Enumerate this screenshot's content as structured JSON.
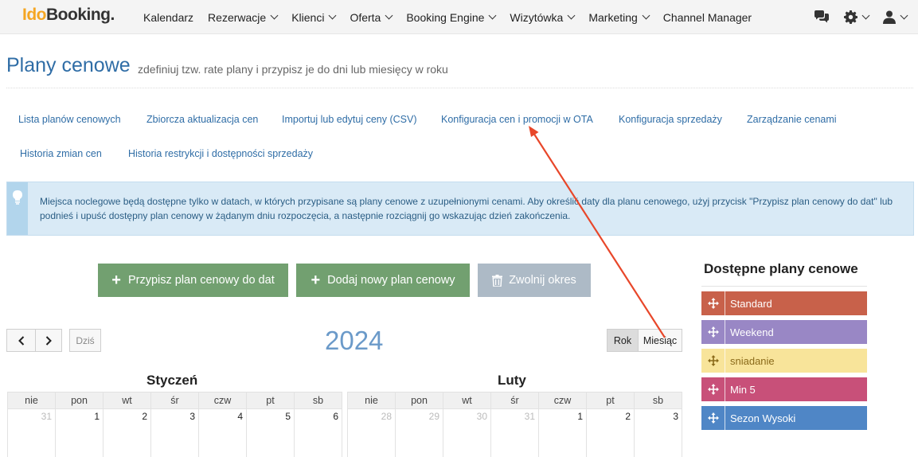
{
  "brand": {
    "ido": "Ido",
    "booking": "Booking",
    "dot": "."
  },
  "nav": [
    {
      "label": "Kalendarz",
      "dropdown": false
    },
    {
      "label": "Rezerwacje",
      "dropdown": true
    },
    {
      "label": "Klienci",
      "dropdown": true
    },
    {
      "label": "Oferta",
      "dropdown": true
    },
    {
      "label": "Booking Engine",
      "dropdown": true
    },
    {
      "label": "Wizytówka",
      "dropdown": true
    },
    {
      "label": "Marketing",
      "dropdown": true
    },
    {
      "label": "Channel Manager",
      "dropdown": false
    }
  ],
  "top_icons": [
    "chat-icon",
    "gear-icon",
    "user-icon"
  ],
  "page": {
    "title": "Plany cenowe",
    "subtitle": "zdefiniuj tzw. rate plany i przypisz je do dni lub miesięcy w roku"
  },
  "sublinks": [
    "Lista planów cenowych",
    "Zbiorcza aktualizacja cen",
    "Importuj lub edytuj ceny (CSV)",
    "Konfiguracja cen i promocji w OTA",
    "Konfiguracja sprzedaży",
    "Zarządzanie cenami",
    "Historia zmian cen",
    "Historia restrykcji i dostępności sprzedaży"
  ],
  "alert": {
    "icon": "lightbulb-icon",
    "text": "Miejsca noclegowe będą dostępne tylko w datach, w których przypisane są plany cenowe z uzupełnionymi cenami. Aby określić daty dla planu cenowego, użyj przycisk \"Przypisz plan cenowy do dat\" lub podnieś i upuść dostępny plan cenowy w żądanym dniu rozpoczęcia, a następnie rozciągnij go wskazując dzień zakończenia."
  },
  "actions": {
    "assign": "Przypisz plan cenowy do dat",
    "add": "Dodaj nowy plan cenowy",
    "release": "Zwolnij okres"
  },
  "available_plans": {
    "title": "Dostępne plany cenowe",
    "items": [
      {
        "name": "Standard",
        "color": "#c8614a",
        "text_color": "#ffffff"
      },
      {
        "name": "Weekend",
        "color": "#9987c5",
        "text_color": "#ffffff"
      },
      {
        "name": "sniadanie",
        "color": "#f8e49a",
        "text_color": "#8a6a1a"
      },
      {
        "name": "Min 5",
        "color": "#c85079",
        "text_color": "#ffffff"
      },
      {
        "name": "Sezon Wysoki",
        "color": "#4f86c6",
        "text_color": "#ffffff"
      }
    ]
  },
  "calendar": {
    "prev_symbol": "‹",
    "next_symbol": "›",
    "today": "Dziś",
    "year": "2024",
    "views": [
      "Rok",
      "Miesiąc"
    ],
    "active_view": "Rok",
    "weekdays": [
      "nie",
      "pon",
      "wt",
      "śr",
      "czw",
      "pt",
      "sb"
    ],
    "months": [
      {
        "name": "Styczeń",
        "first_row": [
          [
            "31",
            true
          ],
          [
            "1",
            false
          ],
          [
            "2",
            false
          ],
          [
            "3",
            false
          ],
          [
            "4",
            false
          ],
          [
            "5",
            false
          ],
          [
            "6",
            false
          ]
        ]
      },
      {
        "name": "Luty",
        "first_row": [
          [
            "28",
            true
          ],
          [
            "29",
            true
          ],
          [
            "30",
            true
          ],
          [
            "31",
            true
          ],
          [
            "1",
            false
          ],
          [
            "2",
            false
          ],
          [
            "3",
            false
          ]
        ]
      }
    ]
  },
  "annotation": {
    "arrow_color": "#e8472a"
  }
}
